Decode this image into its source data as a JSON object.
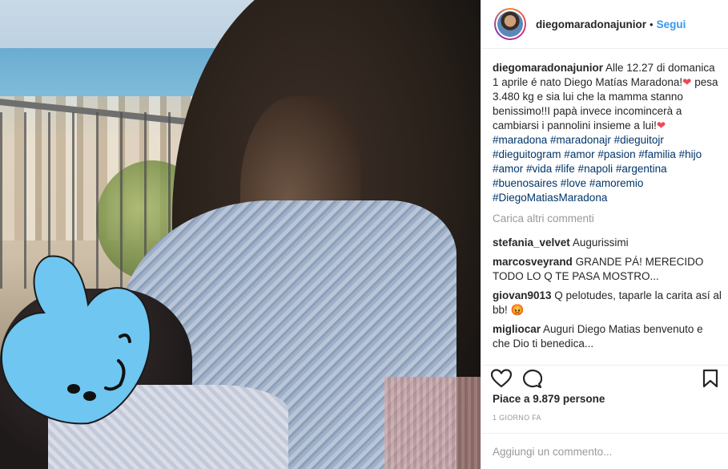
{
  "post": {
    "username": "diegomaradonajunior",
    "follow_label": "Segui",
    "caption": {
      "user": "diegomaradonajunior",
      "text1": " Alle 12.27 di domanica 1 aprile é nato Diego Matías Maradona!",
      "text2": " pesa 3.480 kg e sia lui che la mamma stanno benissimo!!I papà invece incomincerà a cambiarsi i pannolini insieme a lui!",
      "hashtags": "#maradona #maradonajr #dieguitojr #dieguitogram #amor #pasion #familia #hijo #amor #vida #life #napoli #argentina #buenosaires #love #amoremio #DiegoMatiasMaradona"
    },
    "load_more": "Carica altri commenti",
    "comments": [
      {
        "user": "stefania_velvet",
        "text": " Augurissimi"
      },
      {
        "user": "marcosveyrand",
        "text": " GRANDE PÁ! MERECIDO TODO LO Q TE PASA MOSTRO..."
      },
      {
        "user": "giovan9013",
        "text": " Q pelotudes, taparle la carita así al bb! 😡"
      },
      {
        "user": "migliocar",
        "text": " Auguri Diego Matias benvenuto e che Dio ti benedica..."
      }
    ],
    "likes": "Piace a 9.879 persone",
    "time_ago": "1 GIORNO FA",
    "add_comment_placeholder": "Aggiungi un commento..."
  },
  "icons": {
    "like": "heart-outline-icon",
    "comment": "speech-bubble-icon",
    "save": "bookmark-icon",
    "heart_emoji": "red-heart-emoji"
  },
  "colors": {
    "link": "#3897f0",
    "hashtag": "#003569",
    "emoji_heart": "#ed4956",
    "heart_sticker": "#6fc6f0"
  }
}
